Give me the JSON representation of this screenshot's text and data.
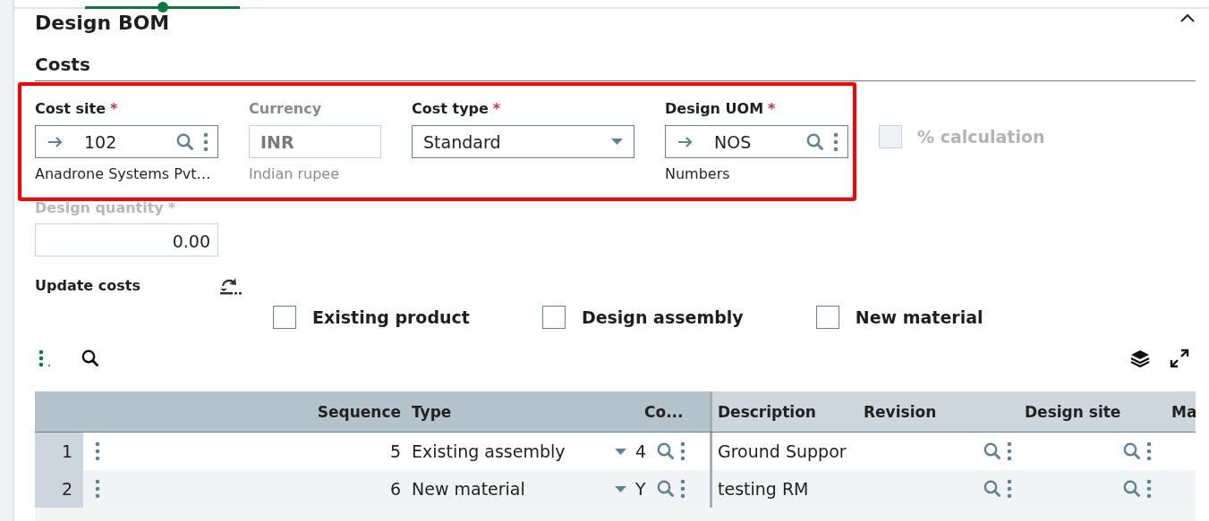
{
  "section": {
    "title": "Design BOM",
    "expanded": true
  },
  "group": {
    "title": "Costs"
  },
  "fields": [
    {
      "kind": "lookup",
      "label": "Cost site",
      "required_mark": "*",
      "value": "102",
      "description": "Anadrone Systems Pvt…"
    },
    {
      "kind": "readonly",
      "label": "Currency",
      "value": "INR",
      "description": "Indian rupee"
    },
    {
      "kind": "select",
      "label": "Cost type",
      "required_mark": "*",
      "value": "Standard"
    },
    {
      "kind": "lookup",
      "label": "Design UOM",
      "required_mark": "*",
      "value": "NOS",
      "description": "Numbers"
    },
    {
      "kind": "checkbox",
      "label": "% calculation",
      "checked": false,
      "disabled": true
    }
  ],
  "design_quantity": {
    "label": "Design quantity",
    "required_mark": "*",
    "disabled": true,
    "value": "0.00"
  },
  "update_costs": {
    "label": "Update costs"
  },
  "options": [
    {
      "label": "Existing product",
      "checked": false
    },
    {
      "label": "Design assembly",
      "checked": false
    },
    {
      "label": "New material",
      "checked": false
    }
  ],
  "grid": {
    "columns": [
      "Sequence",
      "Type",
      "Co...",
      "Description",
      "Revision",
      "Design site",
      "Ma"
    ],
    "rows": [
      {
        "number": "1",
        "sequence": "5",
        "type": "Existing assembly",
        "code": "4",
        "description": "Ground Suppor"
      },
      {
        "number": "2",
        "sequence": "6",
        "type": "New material",
        "code": "Y",
        "description": "testing RM"
      }
    ]
  }
}
